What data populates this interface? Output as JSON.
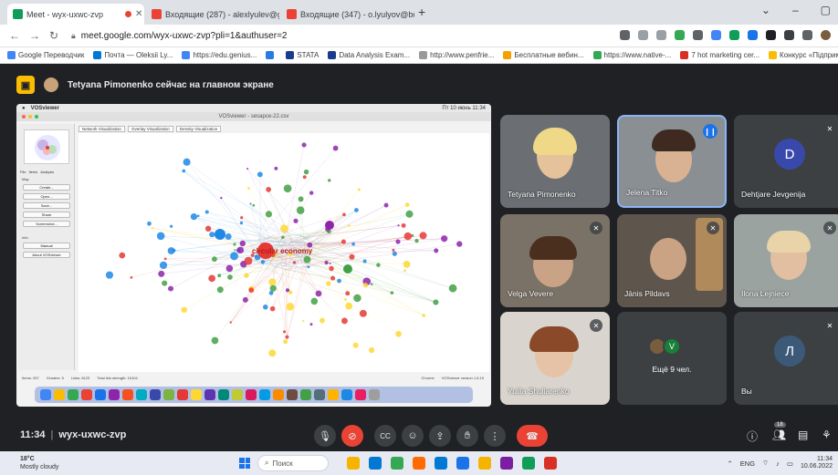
{
  "browser": {
    "tabs": [
      {
        "title": "Meet - wyx-uxwc-zvp",
        "favicon_color": "#0f9d58",
        "recording": true,
        "active": true
      },
      {
        "title": "Входящие (287) - alexlyulev@gi",
        "favicon_color": "#ea4335",
        "active": false
      },
      {
        "title": "Входящие (347) - o.lyulyov@bo",
        "favicon_color": "#ea4335",
        "active": false
      }
    ],
    "new_tab": "+",
    "url": "meet.google.com/wyx-uxwc-zvp?pli=1&authuser=2",
    "bookmarks": [
      {
        "label": "Google Переводчик",
        "color": "#4285f4"
      },
      {
        "label": "Почта — Oleksii Ly...",
        "color": "#0078d4"
      },
      {
        "label": "https://edu.genius...",
        "color": "#4285f4"
      },
      {
        "label": "",
        "color": "#2a7ae2"
      },
      {
        "label": "STATA",
        "color": "#1a3c8c"
      },
      {
        "label": "Data Analysis Exam...",
        "color": "#1a3c8c"
      },
      {
        "label": "http://www.penfrie...",
        "color": "#999999"
      },
      {
        "label": "Бесплатные вебин...",
        "color": "#f4a100"
      },
      {
        "label": "https://www.native-...",
        "color": "#34a853"
      },
      {
        "label": "7 hot marketing cer...",
        "color": "#d93025"
      },
      {
        "label": "Конкурс «Підприм...",
        "color": "#fbbc04"
      }
    ]
  },
  "meet": {
    "presenting_text": "Tetyana Pimonenko сейчас на главном экране",
    "shared_screen": {
      "app_name": "VOSviewer",
      "window_title": "VOSviewer - sesapce-22.csv",
      "menu_clock": "Пт 10 июнь 11:34",
      "tabs": [
        "Network Visualization",
        "Overlay Visualization",
        "Density Visualization"
      ],
      "panel_tabs": [
        "File",
        "Items",
        "Analysis"
      ],
      "panel_map_label": "Map",
      "panel_buttons": [
        "Create...",
        "Open...",
        "Save...",
        "Share",
        "Screenshot..."
      ],
      "panel_info_label": "Info",
      "panel_info_buttons": [
        "Manual",
        "About VOSviewer"
      ],
      "center_label": "circular economy",
      "status": [
        "Items: 257",
        "Clusters: 5",
        "Links: 8123",
        "Total link strength: 16104"
      ],
      "status_right": "Chrome",
      "version": "VOSviewer version 1.6.19"
    },
    "participants": [
      {
        "name": "Tetyana Pimonenko",
        "state": "none"
      },
      {
        "name": "Jelena Titko",
        "state": "speaking"
      },
      {
        "name": "Dehtjare Jevgenija",
        "state": "muted",
        "initial": "D",
        "color": "#3949ab"
      },
      {
        "name": "Velga Vevere",
        "state": "muted"
      },
      {
        "name": "Jānis Pildavs",
        "state": "muted"
      },
      {
        "name": "Ilona Lejniece",
        "state": "muted"
      },
      {
        "name": "Yuliia Shuliarenko",
        "state": "muted"
      },
      {
        "name": "Вы",
        "state": "muted",
        "initial": "Л",
        "color": "#3c5a78"
      }
    ],
    "others": {
      "label": "Ещё 9 чел.",
      "initial": "V",
      "color": "#188038"
    },
    "bottom": {
      "time": "11:34",
      "meeting_code": "wyx-uxwc-zvp",
      "participant_count": "18"
    }
  },
  "taskbar": {
    "temperature": "18°C",
    "weather_text": "Mostly cloudy",
    "search_placeholder": "Поиск",
    "lang": "ENG",
    "time": "11:34",
    "date": "10.06.2022"
  }
}
